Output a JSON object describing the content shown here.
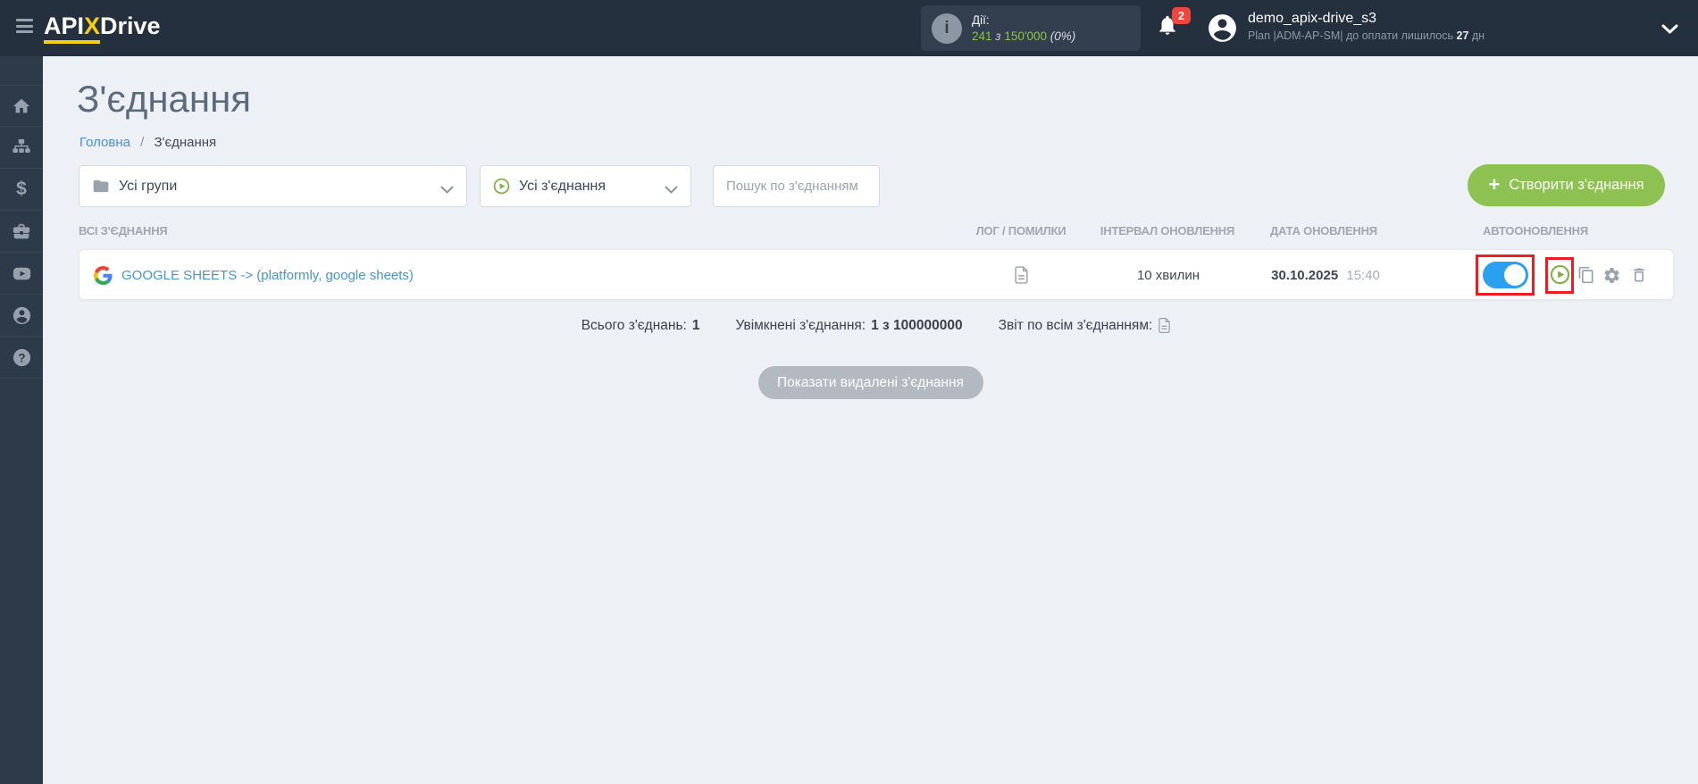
{
  "header": {
    "logo": {
      "api": "API",
      "x": "X",
      "drive": "Drive"
    },
    "actions": {
      "label": "Дії:",
      "info_glyph": "i",
      "used": "241",
      "separator": "з",
      "total": "150'000",
      "percent": "(0%)"
    },
    "notification_badge": "2",
    "user": {
      "name": "demo_apix-drive_s3",
      "plan_text": "Plan |ADM-AP-SM| до оплати лишилось",
      "days": "27",
      "days_suffix": "дн"
    }
  },
  "sidebar": {
    "items": [
      {
        "icon": "home-icon"
      },
      {
        "icon": "sitemap-icon"
      },
      {
        "icon": "dollar-icon"
      },
      {
        "icon": "briefcase-icon"
      },
      {
        "icon": "youtube-icon"
      },
      {
        "icon": "person-icon"
      },
      {
        "icon": "help-icon"
      }
    ],
    "dollar_glyph": "$",
    "question_glyph": "?"
  },
  "page": {
    "title": "З'єднання",
    "breadcrumb_home": "Головна",
    "breadcrumb_separator": "/",
    "breadcrumb_current": "З'єднання"
  },
  "filters": {
    "group_filter": "Усі групи",
    "connection_filter": "Усі з'єднання",
    "search_placeholder": "Пошук по з'єднанням",
    "create_plus": "+",
    "create_label": "Створити з'єднання"
  },
  "table": {
    "headers": [
      "ВСІ З'ЄДНАННЯ",
      "ЛОГ / ПОМИЛКИ",
      "ІНТЕРВАЛ ОНОВЛЕННЯ",
      "ДАТА ОНОВЛЕННЯ",
      "АВТООНОВЛЕННЯ"
    ],
    "row": {
      "name": "GOOGLE SHEETS -> (platformly, google sheets)",
      "interval": "10 хвилин",
      "date": "30.10.2025",
      "time": "15:40",
      "autoupdate_enabled": true
    }
  },
  "summary": {
    "total_label": "Всього з'єднань:",
    "total_value": "1",
    "enabled_label": "Увімкнені з'єднання:",
    "enabled_value": "1 з 100000000",
    "report_label": "Звіт по всім з'єднанням:"
  },
  "footer": {
    "show_deleted_label": "Показати видалені з'єднання"
  },
  "colors": {
    "header_bg": "#25303e",
    "sidebar_bg": "#2d3a4a",
    "page_bg": "#edf0f5",
    "accent_green": "#8bc34a",
    "button_green": "#8dc253",
    "link_blue": "#4694d1",
    "toggle_blue": "#2b9ff0",
    "annotation_red": "#ee1c24",
    "brand_yellow": "#f6cf15",
    "badge_red": "#f2453d"
  }
}
